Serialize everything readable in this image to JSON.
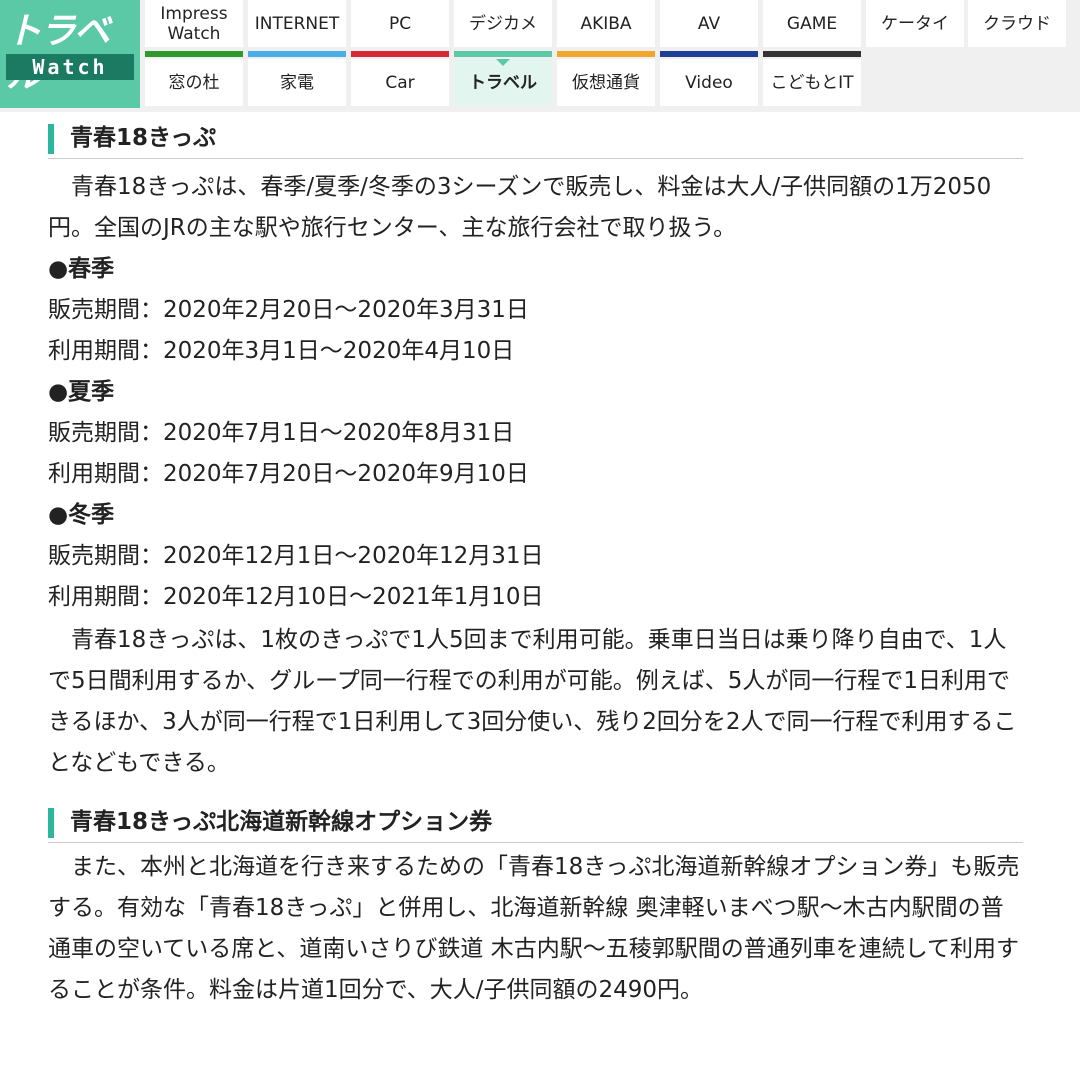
{
  "logo": {
    "line1": "トラベル",
    "line2": "Watch"
  },
  "nav": {
    "row1": [
      {
        "label": "Impress\nWatch",
        "color": "#2e9a2e"
      },
      {
        "label": "INTERNET",
        "color": "#4aaee8"
      },
      {
        "label": "PC",
        "color": "#d42a36"
      },
      {
        "label": "デジカメ",
        "color": "#5bc8a6"
      },
      {
        "label": "AKIBA",
        "color": "#f0a72a"
      },
      {
        "label": "AV",
        "color": "#1e3e96"
      },
      {
        "label": "GAME",
        "color": "#333333"
      },
      {
        "label": "ケータイ",
        "color": ""
      },
      {
        "label": "クラウド",
        "color": ""
      }
    ],
    "row2": [
      {
        "label": "窓の杜"
      },
      {
        "label": "家電"
      },
      {
        "label": "Car"
      },
      {
        "label": "トラベル"
      },
      {
        "label": "仮想通貨"
      },
      {
        "label": "Video"
      },
      {
        "label": "こどもとIT"
      }
    ]
  },
  "section1": {
    "title": "青春18きっぷ",
    "intro": "青春18きっぷは、春季/夏季/冬季の3シーズンで販売し、料金は大人/子供同額の1万2050円。全国のJRの主な駅や旅行センター、主な旅行会社で取り扱う。",
    "seasons": [
      {
        "name": "●春季",
        "sale": "販売期間：2020年2月20日～2020年3月31日",
        "use": "利用期間：2020年3月1日～2020年4月10日"
      },
      {
        "name": "●夏季",
        "sale": "販売期間：2020年7月1日～2020年8月31日",
        "use": "利用期間：2020年7月20日～2020年9月10日"
      },
      {
        "name": "●冬季",
        "sale": "販売期間：2020年12月1日～2020年12月31日",
        "use": "利用期間：2020年12月10日～2021年1月10日"
      }
    ],
    "body": "青春18きっぷは、1枚のきっぷで1人5回まで利用可能。乗車日当日は乗り降り自由で、1人で5日間利用するか、グループ同一行程での利用が可能。例えば、5人が同一行程で1日利用できるほか、3人が同一行程で1日利用して3回分使い、残り2回分を2人で同一行程で利用することなどもできる。"
  },
  "section2": {
    "title": "青春18きっぷ北海道新幹線オプション券",
    "body": "また、本州と北海道を行き来するための「青春18きっぷ北海道新幹線オプション券」も販売する。有効な「青春18きっぷ」と併用し、北海道新幹線 奥津軽いまべつ駅～木古内駅間の普通車の空いている席と、道南いさりび鉄道 木古内駅～五稜郭駅間の普通列車を連続して利用することが条件。料金は片道1回分で、大人/子供同額の2490円。"
  }
}
